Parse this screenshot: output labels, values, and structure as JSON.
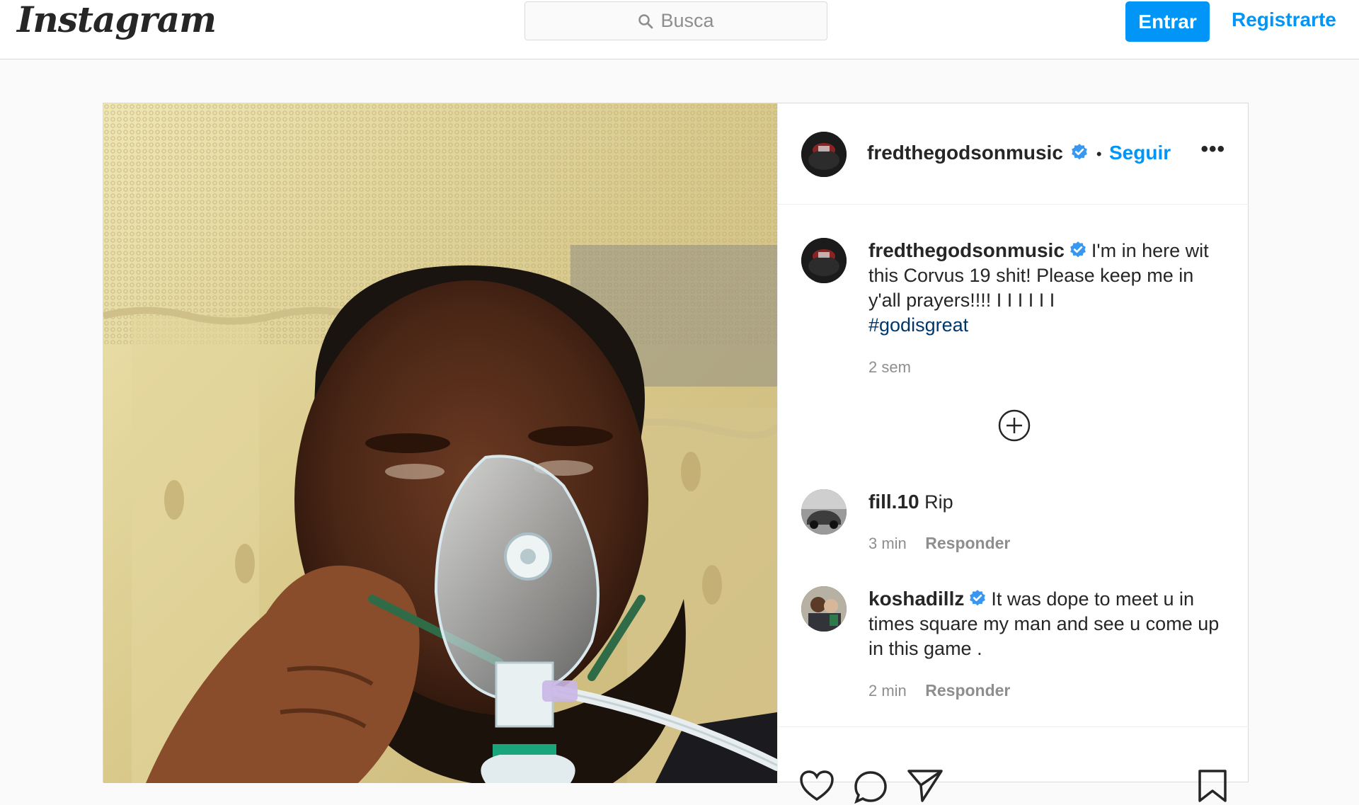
{
  "topbar": {
    "logo": "Instagram",
    "search_placeholder": "Busca",
    "login_label": "Entrar",
    "register_label": "Registrarte"
  },
  "post": {
    "author": "fredthegodsonmusic",
    "follow_label": "Seguir",
    "separator": "•",
    "more_label": "•••",
    "caption": {
      "username": "fredthegodsonmusic",
      "text": "I'm in here wit this Corvus 19 shit! Please keep me in y'all prayers!!!! I I I I I I",
      "hashtag": "#godisgreat",
      "time": "2 sem"
    },
    "comments": [
      {
        "username": "fill.10",
        "verified": false,
        "text": "Rip",
        "time": "3 min",
        "reply": "Responder"
      },
      {
        "username": "koshadillz",
        "verified": true,
        "text": "It was dope to meet u in times square my man and see u come up in this game .",
        "time": "2 min",
        "reply": "Responder"
      }
    ]
  },
  "colors": {
    "accent": "#0095f6",
    "border": "#dbdbdb",
    "hashtag": "#00376b",
    "muted": "#8e8e8e"
  },
  "icons": [
    "search-icon",
    "verified-badge-icon",
    "more-options-icon",
    "load-more-comments-icon",
    "heart-icon",
    "comment-icon",
    "share-icon",
    "bookmark-icon"
  ]
}
